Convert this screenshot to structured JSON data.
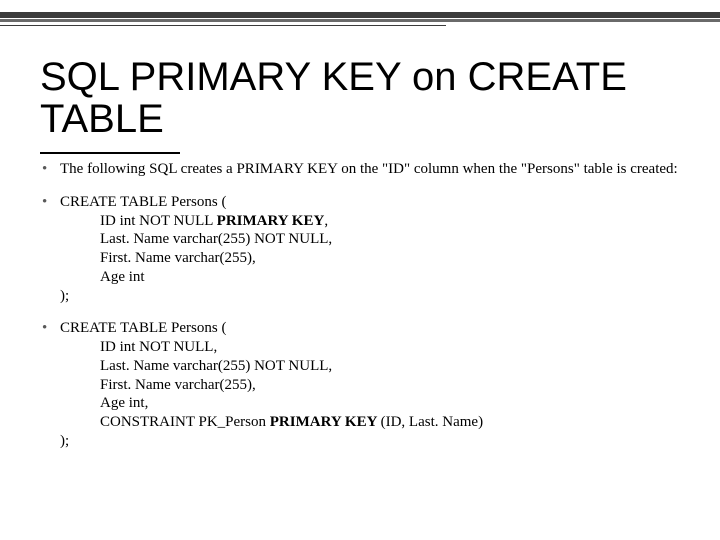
{
  "title": "SQL PRIMARY KEY on CREATE TABLE",
  "bullets": {
    "intro": "The following SQL creates a PRIMARY KEY on the \"ID\" column when the \"Persons\" table is created:",
    "code1": {
      "open": "CREATE TABLE Persons (",
      "l1a": "    ID int NOT NULL ",
      "l1b": "PRIMARY KEY",
      "l1c": ",",
      "l2": "    Last. Name varchar(255) NOT NULL,",
      "l3": "    First. Name varchar(255),",
      "l4": "    Age int",
      "close": ");"
    },
    "code2": {
      "open": "CREATE TABLE Persons (",
      "l1": "    ID int NOT NULL,",
      "l2": "    Last. Name varchar(255) NOT NULL,",
      "l3": "    First. Name varchar(255),",
      "l4": "    Age int,",
      "l5a": "    CONSTRAINT PK_Person ",
      "l5b": "PRIMARY KEY ",
      "l5c": "(ID, Last. Name)",
      "close": ");"
    }
  }
}
